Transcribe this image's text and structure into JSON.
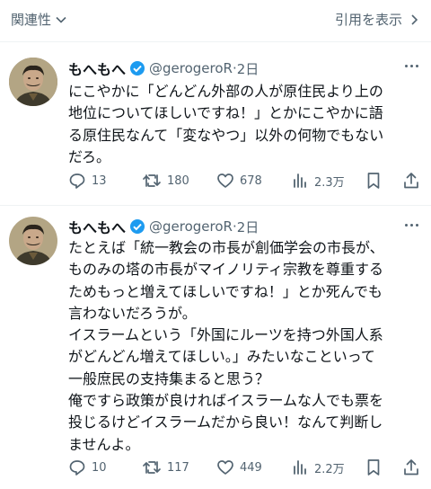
{
  "topbar": {
    "related_label": "関連性",
    "quote_label": "引用を表示"
  },
  "colors": {
    "text": "#0f1419",
    "muted": "#536471",
    "verified": "#1d9bf0"
  },
  "tweets": [
    {
      "name": "もへもへ",
      "handle": "@gerogeroR",
      "sep": "·",
      "time": "2日",
      "lines": [
        "にこやかに「どんどん外部の人が原住民より上の",
        "地位についてほしいですね！」とかにこやかに語",
        "る原住民なんて「変なやつ」以外の何物でもない",
        "だろ。"
      ],
      "replies": "13",
      "reposts": "180",
      "likes": "678",
      "views": "2.3万"
    },
    {
      "name": "もへもへ",
      "handle": "@gerogeroR",
      "sep": "·",
      "time": "2日",
      "lines": [
        "たとえば「統一教会の市長が創価学会の市長が、",
        "ものみの塔の市長がマイノリティ宗教を尊重する",
        "ためもっと増えてほしいですね！」とか死んでも",
        "言わないだろうが。",
        "イスラームという「外国にルーツを持つ外国人系",
        "がどんどん増えてほしい。」みたいなこといって",
        "一般庶民の支持集まると思う？",
        "俺ですら政策が良ければイスラームな人でも票を",
        "投じるけどイスラームだから良い！なんて判断し",
        "ませんよ。"
      ],
      "replies": "10",
      "reposts": "117",
      "likes": "449",
      "views": "2.2万"
    }
  ]
}
